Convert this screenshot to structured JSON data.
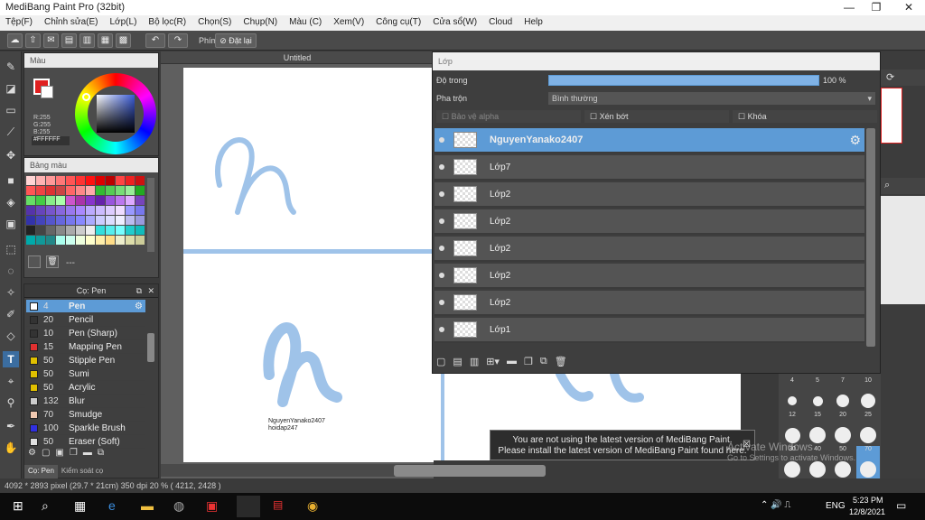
{
  "window": {
    "title": "MediBang Paint Pro (32bit)",
    "min": "—",
    "max": "❐",
    "close": "✕"
  },
  "menu": [
    "Tệp(F)",
    "Chỉnh sửa(E)",
    "Lớp(L)",
    "Bộ lọc(R)",
    "Chọn(S)",
    "Chụp(N)",
    "Màu (C)",
    "Xem(V)",
    "Công cụ(T)",
    "Cửa sổ(W)",
    "Cloud",
    "Help"
  ],
  "toolbar": {
    "phim_label": "Phím",
    "reset_label": "Đặt lại"
  },
  "color_panel": {
    "title": "Màu",
    "r": "R:255",
    "g": "G:255",
    "b": "B:255",
    "hex": "#FFFFFF"
  },
  "palette_panel": {
    "title": "Bảng màu",
    "footer": "---"
  },
  "brush_panel": {
    "title": "Cọ: Pen",
    "tab1": "Cọ: Pen",
    "tab2": "Kiểm soát cọ",
    "items": [
      {
        "size": "4",
        "name": "Pen"
      },
      {
        "size": "20",
        "name": "Pencil"
      },
      {
        "size": "10",
        "name": "Pen (Sharp)"
      },
      {
        "size": "15",
        "name": "Mapping Pen"
      },
      {
        "size": "50",
        "name": "Stipple Pen"
      },
      {
        "size": "50",
        "name": "Sumi"
      },
      {
        "size": "50",
        "name": "Acrylic"
      },
      {
        "size": "132",
        "name": "Blur"
      },
      {
        "size": "70",
        "name": "Smudge"
      },
      {
        "size": "100",
        "name": "Sparkle Brush"
      },
      {
        "size": "50",
        "name": "Eraser (Soft)"
      }
    ]
  },
  "canvas": {
    "title": "Untitled",
    "sig1": "NguyenYanako2407",
    "sig2": "hoidap247"
  },
  "layer_panel": {
    "title": "Lớp",
    "opacity_label": "Độ trong",
    "opacity_value": "100 %",
    "opacity": 1.0,
    "blend_label": "Pha trộn",
    "blend_value": "Bình thường",
    "protect_alpha": "Bảo vệ alpha",
    "clip": "Xén bớt",
    "lock": "Khóa",
    "layers": [
      "NguyenYanako2407",
      "Lớp7",
      "Lớp2",
      "Lớp2",
      "Lớp2",
      "Lớp2",
      "Lớp2",
      "Lớp1"
    ]
  },
  "brush_sizes": [
    "4",
    "5",
    "7",
    "10",
    "12",
    "15",
    "20",
    "25",
    "30",
    "40",
    "50",
    "70"
  ],
  "notice": {
    "line1": "You are not using the latest version of MediBang Paint.",
    "line2": "Please install the latest version of MediBang Paint found here."
  },
  "watermark": {
    "line1": "Activate Windows",
    "line2": "Go to Settings to activate Windows."
  },
  "status": {
    "text": "4092 * 2893 pixel  (29.7 * 21cm)  350 dpi  20 %  ( 4212, 2428 )"
  },
  "taskbar": {
    "lang": "ENG",
    "time": "5:23 PM",
    "date": "12/8/2021"
  },
  "colors": {
    "accent": "#5d9bd6",
    "stroke": "#9fc3e9"
  }
}
